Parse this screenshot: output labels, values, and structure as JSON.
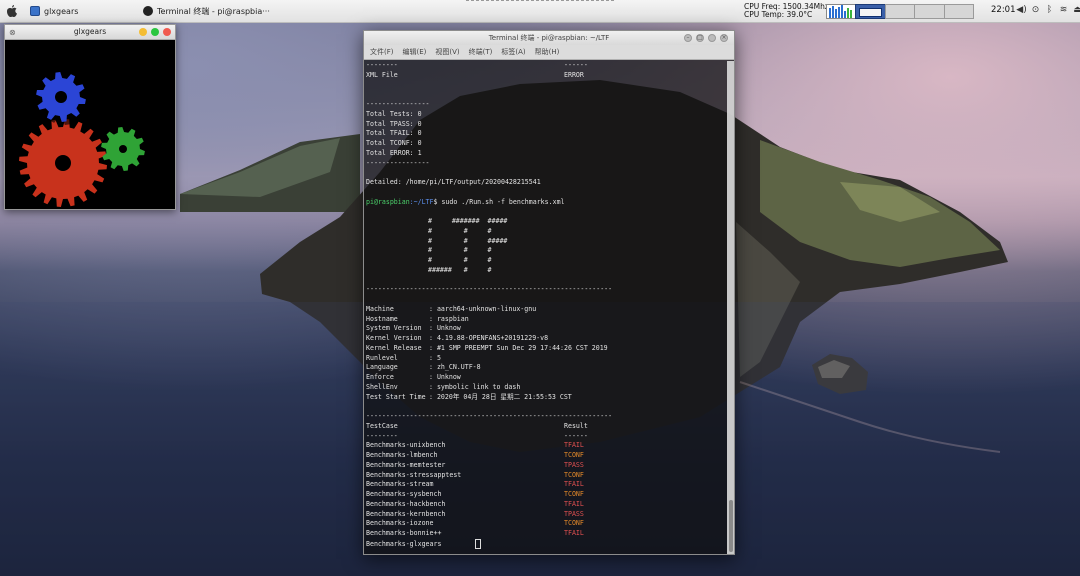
{
  "panel": {
    "tasks": [
      {
        "label": "glxgears"
      },
      {
        "label": "Terminal 终端 - pi@raspbia···"
      }
    ],
    "cpu_freq": "CPU Freq: 1500.34Mhz",
    "cpu_temp": "CPU Temp: 39.0°C",
    "clock": "22:01"
  },
  "glxgears": {
    "title": "glxgears",
    "gear_colors": {
      "red": "#c8321c",
      "green": "#2fa336",
      "blue": "#2b45d6"
    }
  },
  "terminal": {
    "title": "Terminal 终端 - pi@raspbian: ~/LTF",
    "menu": [
      "文件(F)",
      "编辑(E)",
      "视图(V)",
      "终端(T)",
      "标签(A)",
      "帮助(H)"
    ],
    "top_sep_left": "--------",
    "top_sep_right": "------",
    "xml_label": "XML File",
    "xml_value": "ERROR",
    "dash_line": "----------------",
    "totals": [
      "Total Tests: 0",
      "Total TPASS: 0",
      "Total TFAIL: 0",
      "Total TCONF: 0",
      "Total ERROR: 1"
    ],
    "detailed": "Detailed: /home/pi/LTF/output/20200428215541",
    "prompt_user": "pi@raspbian",
    "prompt_path": ":~/LTF",
    "prompt_cmd": "$ sudo ./Run.sh -f benchmarks.xml",
    "ascii_art": [
      "#     #######  #####",
      "#        #     #",
      "#        #     #####",
      "#        #     #",
      "#        #     #",
      "######   #     #"
    ],
    "long_sep": "--------------------------------------------------------------",
    "sysinfo": [
      {
        "key": "Machine",
        "value": ": aarch64-unknown-linux-gnu"
      },
      {
        "key": "Hostname",
        "value": ": raspbian"
      },
      {
        "key": "System Version",
        "value": ": Unknow"
      },
      {
        "key": "Kernel Version",
        "value": ": 4.19.88-OPENFANS+20191229-v8"
      },
      {
        "key": "Kernel Release",
        "value": ": #1 SMP PREEMPT Sun Dec 29 17:44:26 CST 2019"
      },
      {
        "key": "Runlevel",
        "value": ": 5"
      },
      {
        "key": "Language",
        "value": ": zh_CN.UTF-8"
      },
      {
        "key": "Enforce",
        "value": ": Unknow"
      },
      {
        "key": "ShellEnv",
        "value": ": symbolic link to dash"
      },
      {
        "key": "Test Start Time",
        "value": ": 2020年 04月 28日 星期二 21:55:53 CST"
      }
    ],
    "col_testcase": "TestCase",
    "col_result": "Result",
    "col_sep_left": "--------",
    "col_sep_right": "------",
    "tests": [
      {
        "name": "Benchmarks-unixbench",
        "result": "TFAIL",
        "color": "red"
      },
      {
        "name": "Benchmarks-lmbench",
        "result": "TCONF",
        "color": "orange"
      },
      {
        "name": "Benchmarks-memtester",
        "result": "TPASS",
        "color": "red"
      },
      {
        "name": "Benchmarks-stressapptest",
        "result": "TCONF",
        "color": "orange"
      },
      {
        "name": "Benchmarks-stream",
        "result": "TFAIL",
        "color": "red"
      },
      {
        "name": "Benchmarks-sysbench",
        "result": "TCONF",
        "color": "orange"
      },
      {
        "name": "Benchmarks-hackbench",
        "result": "TFAIL",
        "color": "red"
      },
      {
        "name": "Benchmarks-kernbench",
        "result": "TPASS",
        "color": "red"
      },
      {
        "name": "Benchmarks-iozone",
        "result": "TCONF",
        "color": "orange"
      },
      {
        "name": "Benchmarks-bonnie++",
        "result": "TFAIL",
        "color": "red"
      },
      {
        "name": "Benchmarks-glxgears",
        "result": "",
        "color": "red"
      }
    ]
  }
}
